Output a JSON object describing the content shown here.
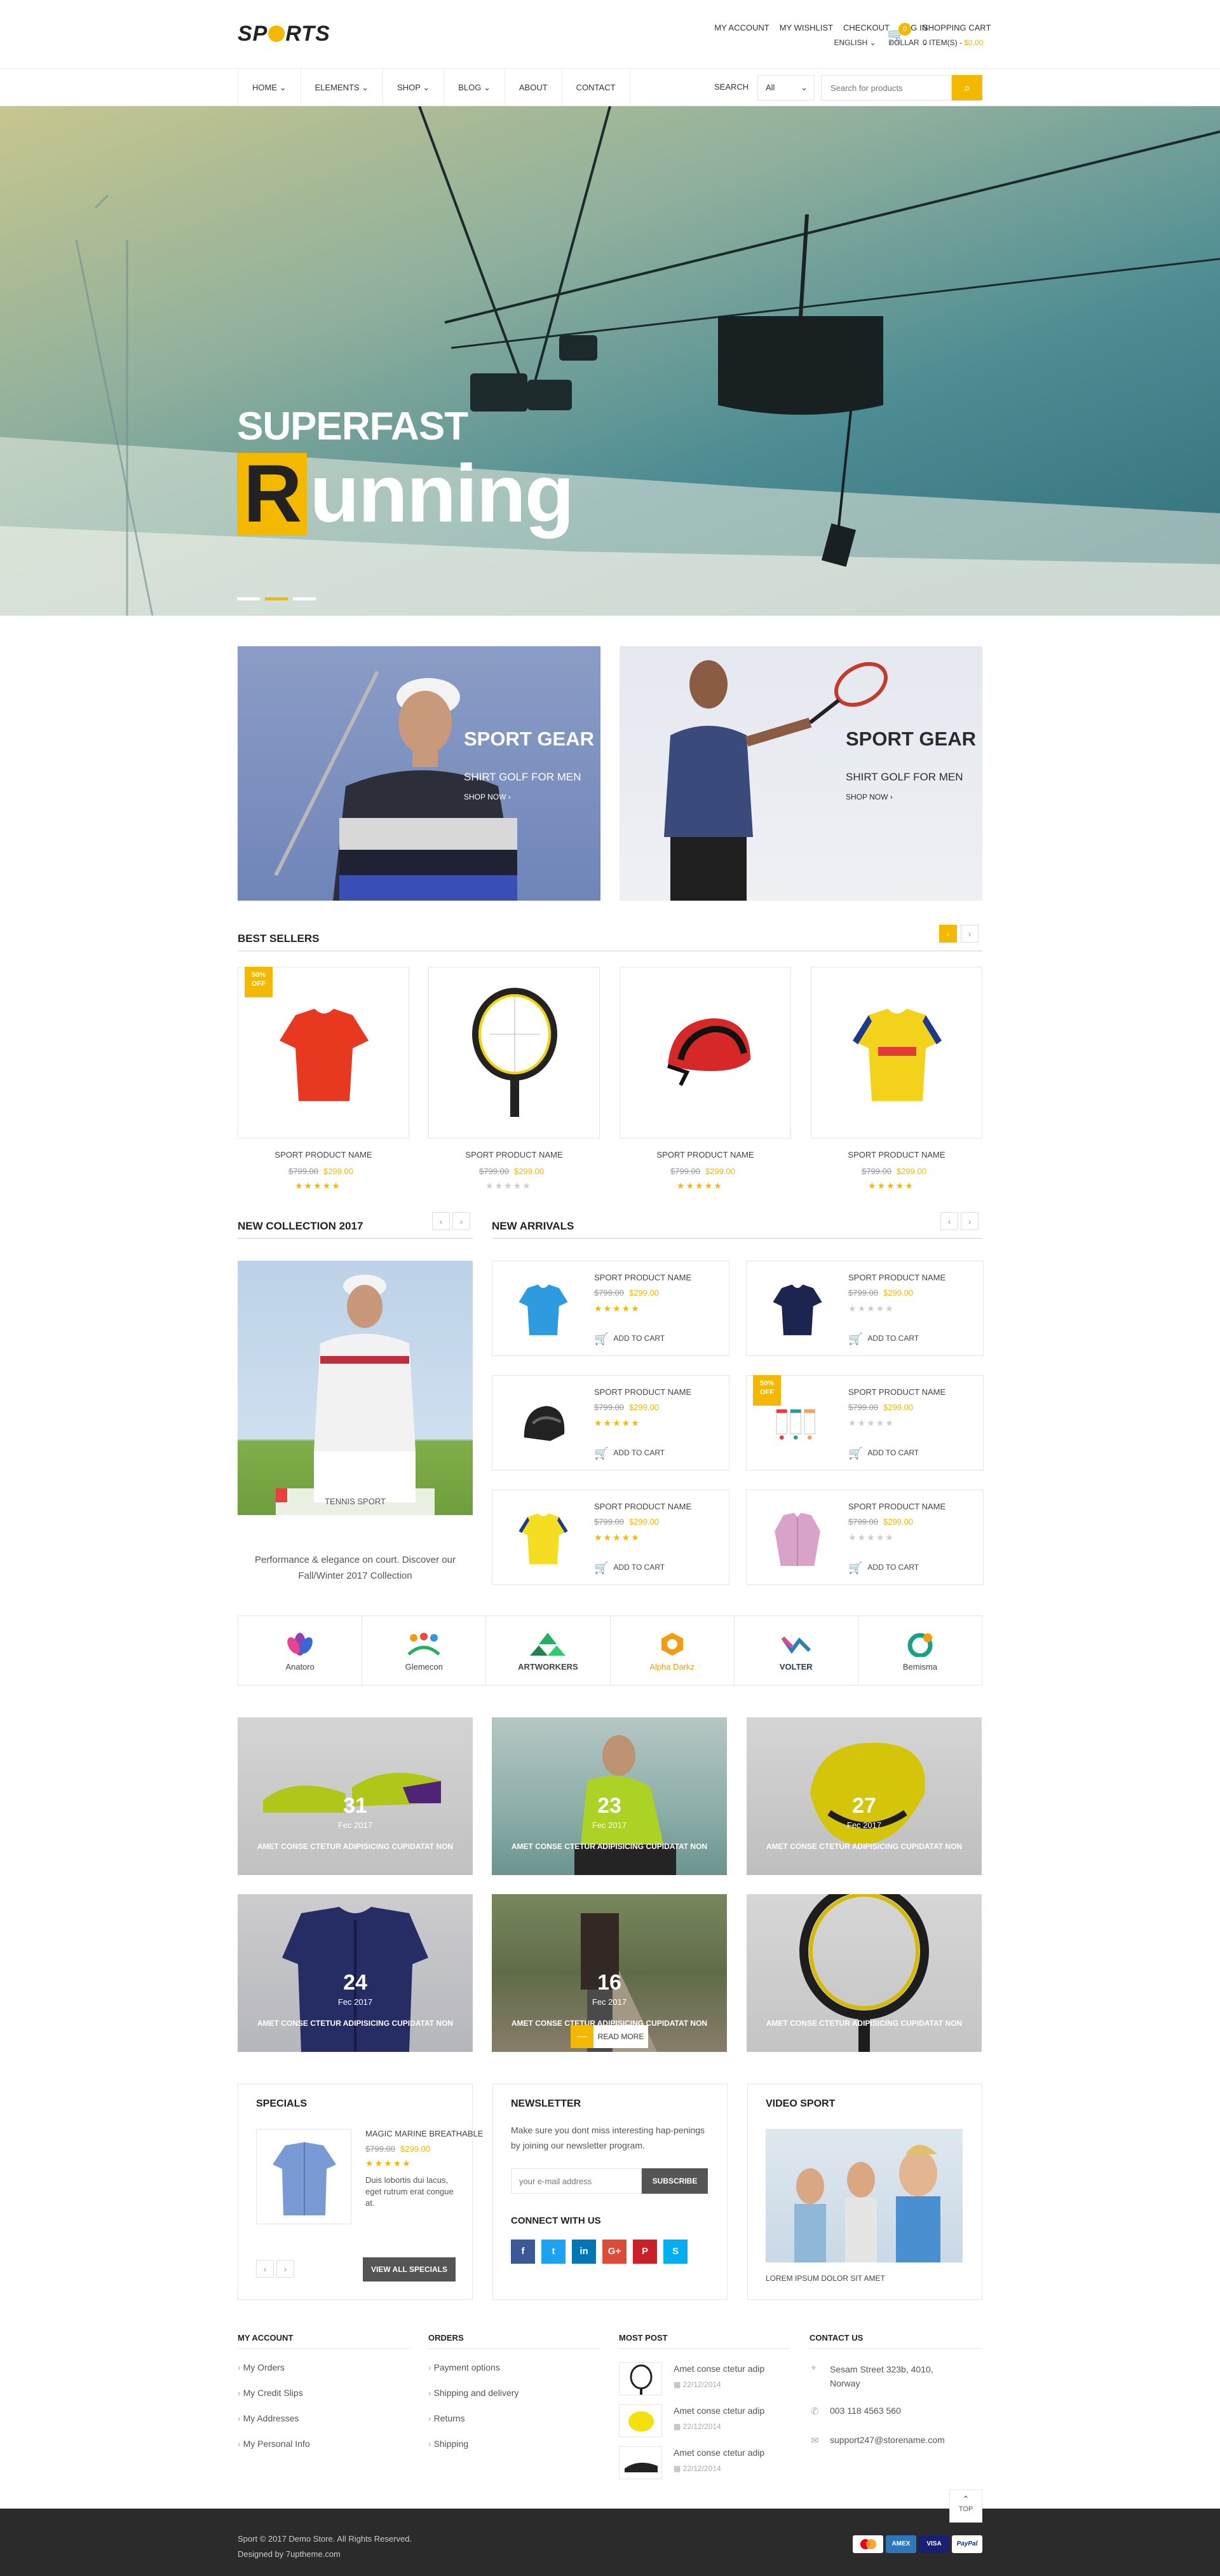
{
  "header": {
    "logo_text": "SPORTS",
    "top_links": [
      "MY ACCOUNT",
      "MY WISHLIST",
      "CHECKOUT",
      "LOG IN"
    ],
    "language": "ENGLISH",
    "currency": "DOLLAR",
    "cart_title": "SHOPPING CART",
    "cart_items": "0 ITEM(S) -",
    "cart_total": "$0.00",
    "cart_count": "0"
  },
  "nav": {
    "items": [
      "HOME",
      "ELEMENTS",
      "SHOP",
      "BLOG",
      "ABOUT",
      "CONTACT"
    ],
    "search_label": "SEARCH",
    "category_select": "All",
    "search_placeholder": "Search for products"
  },
  "hero": {
    "subtitle": "SUPERFAST",
    "title_first": "R",
    "title_rest": "unning",
    "slide_count": 3,
    "active_slide": 2
  },
  "banners": [
    {
      "title": "SPORT GEAR",
      "subtitle": "SHIRT GOLF FOR MEN",
      "link": "SHOP NOW ›"
    },
    {
      "title": "SPORT GEAR",
      "subtitle": "SHIRT GOLF FOR MEN",
      "link": "SHOP NOW ›"
    }
  ],
  "best_sellers": {
    "title": "BEST SELLERS",
    "products": [
      {
        "name": "SPORT PRODUCT NAME",
        "old_price": "$799.00",
        "price": "$299.00",
        "rating": 5,
        "badge": "50% OFF",
        "image": "red-sports-shirt"
      },
      {
        "name": "SPORT PRODUCT NAME",
        "old_price": "$799.00",
        "price": "$299.00",
        "rating": 0,
        "badge": "",
        "image": "tennis-racket"
      },
      {
        "name": "SPORT PRODUCT NAME",
        "old_price": "$799.00",
        "price": "$299.00",
        "rating": 5,
        "badge": "",
        "image": "bike-helmet"
      },
      {
        "name": "SPORT PRODUCT NAME",
        "old_price": "$799.00",
        "price": "$299.00",
        "rating": 5,
        "badge": "",
        "image": "yellow-football-shirt"
      }
    ]
  },
  "collection": {
    "title": "NEW COLLECTION 2017",
    "label": "TENNIS SPORT",
    "text": "Performance & elegance on court. Discover our Fall/Winter 2017 Collection"
  },
  "new_arrivals": {
    "title": "NEW ARRIVALS",
    "add_to_cart": "ADD TO CART",
    "products": [
      {
        "name": "SPORT PRODUCT NAME",
        "old_price": "$799.00",
        "price": "$299.00",
        "rating": 5,
        "badge": "",
        "image": "blue-polo-shirt"
      },
      {
        "name": "SPORT PRODUCT NAME",
        "old_price": "$799.00",
        "price": "$299.00",
        "rating": 0,
        "badge": "",
        "image": "navy-polo-shirt"
      },
      {
        "name": "SPORT PRODUCT NAME",
        "old_price": "$799.00",
        "price": "$299.00",
        "rating": 5,
        "badge": "",
        "image": "black-helmet"
      },
      {
        "name": "SPORT PRODUCT NAME",
        "old_price": "$799.00",
        "price": "$299.00",
        "rating": 0,
        "badge": "50% OFF",
        "image": "sport-socks"
      },
      {
        "name": "SPORT PRODUCT NAME",
        "old_price": "$799.00",
        "price": "$299.00",
        "rating": 5,
        "badge": "",
        "image": "yellow-jersey"
      },
      {
        "name": "SPORT PRODUCT NAME",
        "old_price": "$799.00",
        "price": "$299.00",
        "rating": 0,
        "badge": "",
        "image": "pink-shirt"
      }
    ]
  },
  "brands": [
    "Anatoro",
    "Glemecon",
    "ARTWORKERS",
    "Alpha Darkz",
    "VOLTER",
    "Bemisma"
  ],
  "blog": [
    {
      "day": "31",
      "month": "Fec 2017",
      "title": "AMET CONSE CTETUR ADIPISICING CUPIDATAT NON",
      "image": "football-boots"
    },
    {
      "day": "23",
      "month": "Fec 2017",
      "title": "AMET CONSE CTETUR ADIPISICING CUPIDATAT NON",
      "image": "runner-woman"
    },
    {
      "day": "27",
      "month": "Fec 2017",
      "title": "AMET CONSE CTETUR ADIPISICING CUPIDATAT NON",
      "image": "yellow-gloves"
    },
    {
      "day": "24",
      "month": "Fec 2017",
      "title": "AMET CONSE CTETUR ADIPISICING CUPIDATAT NON",
      "image": "navy-jacket"
    },
    {
      "day": "16",
      "month": "Fec 2017",
      "title": "AMET CONSE CTETUR ADIPISICING CUPIDATAT NON",
      "image": "jogging-path",
      "read_more": "READ MORE"
    },
    {
      "day": "",
      "month": "",
      "title": "AMET CONSE CTETUR ADIPISICING CUPIDATAT NON",
      "image": "racket-closeup"
    }
  ],
  "specials": {
    "title": "SPECIALS",
    "product_name": "MAGIC MARINE BREATHABLE",
    "old_price": "$799.00",
    "price": "$299.00",
    "rating": 5,
    "description": "Duis lobortis dui lacus, eget rutrum erat congue at.",
    "view_all": "VIEW ALL SPECIALS"
  },
  "newsletter": {
    "title": "NEWSLETTER",
    "text": "Make sure you dont miss interesting hap-penings by joining our newsletter program.",
    "placeholder": "your e-mail address",
    "button": "SUBSCRIBE",
    "connect_title": "CONNECT WITH US",
    "social": [
      {
        "icon": "facebook-icon",
        "glyph": "f",
        "color": "#3b5998"
      },
      {
        "icon": "twitter-icon",
        "glyph": "t",
        "color": "#1da1f2"
      },
      {
        "icon": "linkedin-icon",
        "glyph": "in",
        "color": "#0077b5"
      },
      {
        "icon": "google-plus-icon",
        "glyph": "G+",
        "color": "#dd4b39"
      },
      {
        "icon": "pinterest-icon",
        "glyph": "P",
        "color": "#cb2027"
      },
      {
        "icon": "skype-icon",
        "glyph": "S",
        "color": "#00aff0"
      }
    ]
  },
  "video": {
    "title": "VIDEO SPORT",
    "caption": "LOREM IPSUM DOLOR SIT AMET"
  },
  "footer": {
    "my_account": {
      "title": "MY ACCOUNT",
      "links": [
        "My Orders",
        "My Credit Slips",
        "My Addresses",
        "My Personal Info"
      ]
    },
    "orders": {
      "title": "ORDERS",
      "links": [
        "Payment options",
        "Shipping and delivery",
        "Returns",
        "Shipping"
      ]
    },
    "most_post": {
      "title": "MOST POST",
      "posts": [
        {
          "title": "Amet conse ctetur adip",
          "date": "22/12/2014"
        },
        {
          "title": "Amet conse ctetur adip",
          "date": "22/12/2014"
        },
        {
          "title": "Amet conse ctetur adip",
          "date": "22/12/2014"
        }
      ]
    },
    "contact": {
      "title": "CONTACT US",
      "address": "Sesam Street 323b, 4010, Norway",
      "phone": "003 118 4563 560",
      "email": "support247@storename.com"
    },
    "top_button": "TOP",
    "copyright": "Sport © 2017 Demo Store. All Rights Reserved.",
    "designed_by": "Designed by 7uptheme.com",
    "payments": [
      "MasterCard",
      "AMEX",
      "VISA",
      "PayPal"
    ]
  },
  "colors": {
    "accent": "#f4b800",
    "footer_bg": "#2b2b2b"
  }
}
